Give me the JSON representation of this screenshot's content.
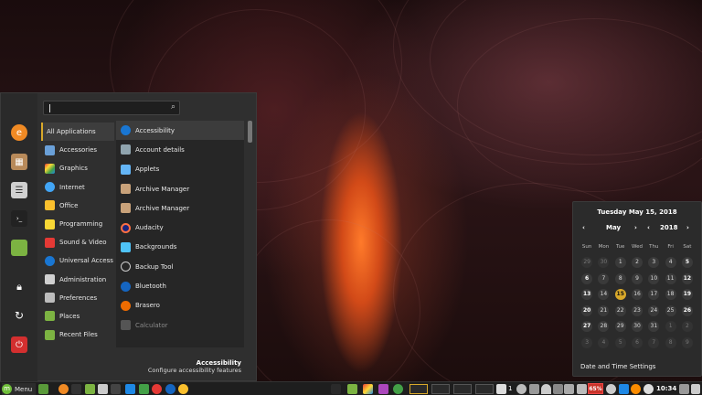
{
  "menu": {
    "search_placeholder": "",
    "favorites": [
      "firefox-icon",
      "archive-icon",
      "settings-icon",
      "terminal-icon",
      "folder-icon",
      "lock-icon",
      "logout-icon",
      "power-icon"
    ],
    "categories": [
      {
        "label": "All Applications",
        "selected": true
      },
      {
        "label": "Accessories"
      },
      {
        "label": "Graphics"
      },
      {
        "label": "Internet"
      },
      {
        "label": "Office"
      },
      {
        "label": "Programming"
      },
      {
        "label": "Sound & Video"
      },
      {
        "label": "Universal Access"
      },
      {
        "label": "Administration"
      },
      {
        "label": "Preferences"
      },
      {
        "label": "Places"
      },
      {
        "label": "Recent Files"
      }
    ],
    "apps": [
      {
        "label": "Accessibility",
        "selected": true
      },
      {
        "label": "Account details"
      },
      {
        "label": "Applets"
      },
      {
        "label": "Archive Manager"
      },
      {
        "label": "Archive Manager"
      },
      {
        "label": "Audacity"
      },
      {
        "label": "Backgrounds"
      },
      {
        "label": "Backup Tool"
      },
      {
        "label": "Bluetooth"
      },
      {
        "label": "Brasero"
      },
      {
        "label": "Calculator",
        "dim": true
      }
    ],
    "description": {
      "title": "Accessibility",
      "subtitle": "Configure accessibility features"
    }
  },
  "calendar": {
    "date_title": "Tuesday May 15, 2018",
    "month": "May",
    "year": "2018",
    "weekdays": [
      "Sun",
      "Mon",
      "Tue",
      "Wed",
      "Thu",
      "Fri",
      "Sat"
    ],
    "weeks": [
      [
        "29",
        "30",
        "1",
        "2",
        "3",
        "4",
        "5"
      ],
      [
        "6",
        "7",
        "8",
        "9",
        "10",
        "11",
        "12"
      ],
      [
        "13",
        "14",
        "15",
        "16",
        "17",
        "18",
        "19"
      ],
      [
        "20",
        "21",
        "22",
        "23",
        "24",
        "25",
        "26"
      ],
      [
        "27",
        "28",
        "29",
        "30",
        "31",
        "1",
        "2"
      ],
      [
        "3",
        "4",
        "5",
        "6",
        "7",
        "8",
        "9"
      ]
    ],
    "today": "15",
    "settings_label": "Date and Time Settings"
  },
  "panel": {
    "menu_label": "Menu",
    "battery": "65%",
    "notifications": "1",
    "clock": "10:34",
    "colors": {
      "mint": "#6fbf3a",
      "accent": "#d9a92a",
      "battery": "#c9342a"
    }
  }
}
